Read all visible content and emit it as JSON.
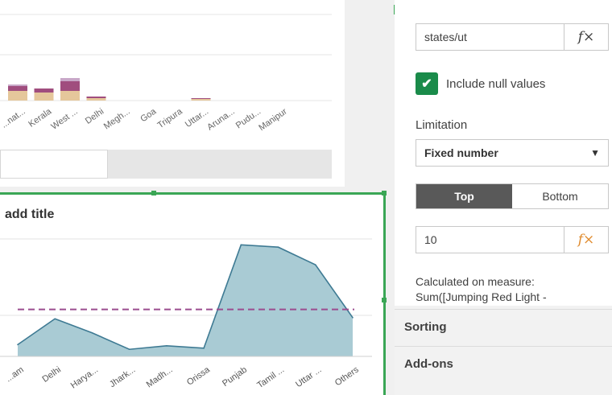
{
  "top_chart": {
    "tick_labels": [
      "...nat...",
      "Kerala",
      "West ...",
      "Delhi",
      "Megh...",
      "Goa",
      "Tripura",
      "Uttar...",
      "Aruna...",
      "Pudu...",
      "Manipur"
    ],
    "stack_colors": [
      "#e5c79b",
      "#a04d7e",
      "#c8a8c8"
    ]
  },
  "bottom_chart": {
    "title": "add title",
    "chart_data": {
      "type": "area",
      "title": "add title",
      "categories": [
        "...am",
        "Delhi",
        "Harya...",
        "Jhark...",
        "Madh...",
        "Orissa",
        "Punjab",
        "Tamil ...",
        "Uttar ...",
        "Others"
      ],
      "values": [
        10,
        32,
        20,
        6,
        9,
        7,
        95,
        93,
        78,
        33
      ],
      "reference_line": 40,
      "ylim": [
        0,
        100
      ],
      "fill_color": "#a9cbd4",
      "line_color": "#3e7a93",
      "reference_color": "#9b4d8f",
      "grid": true
    }
  },
  "panel": {
    "field_value": "states/ut",
    "fx_symbol": "𝑓×",
    "include_null_label": "Include null values",
    "check_glyph": "✔",
    "limitation_label": "Limitation",
    "limitation_value": "Fixed number",
    "dropdown_arrow": "▼",
    "top_label": "Top",
    "bottom_label": "Bottom",
    "limit_value": "10",
    "calculated_text": "Calculated on measure: Sum([Jumping Red Light -",
    "sorting_label": "Sorting",
    "addons_label": "Add-ons",
    "accent_color": "#1a8b4a",
    "fx_highlight": "#e08b2e"
  }
}
